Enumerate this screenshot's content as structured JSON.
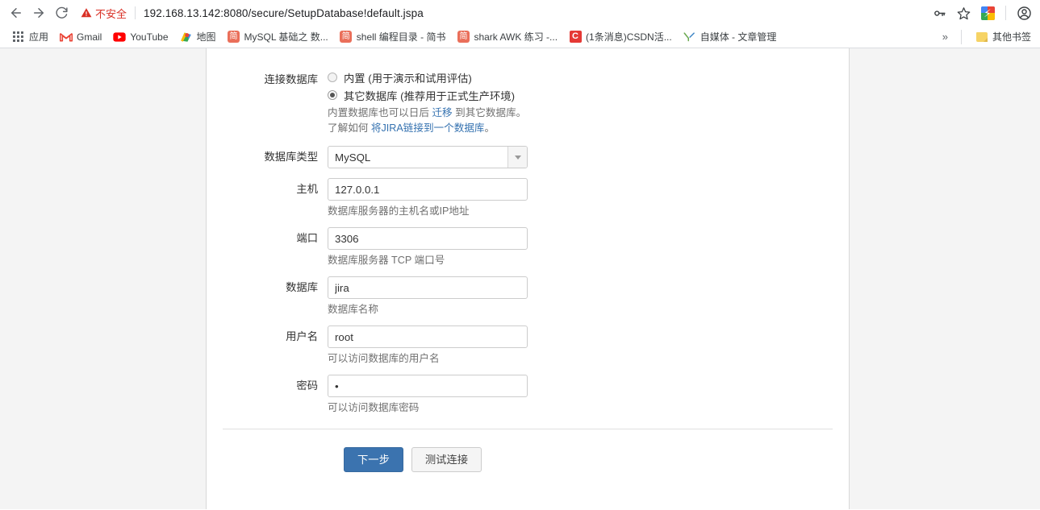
{
  "browser": {
    "nav": {
      "back": "back-arrow",
      "forward": "forward-arrow",
      "reload": "reload"
    },
    "omnibox": {
      "security_label": "不安全",
      "url": "192.168.13.142:8080/secure/SetupDatabase!default.jspa"
    },
    "toolbar_right": {
      "key_icon": "key-icon",
      "star_icon": "star-icon",
      "extension_icon": "extension-icon",
      "profile_icon": "profile-avatar"
    },
    "bookmarks": [
      {
        "label": "应用",
        "icon": "apps-grid"
      },
      {
        "label": "Gmail",
        "icon": "gmail"
      },
      {
        "label": "YouTube",
        "icon": "youtube"
      },
      {
        "label": "地图",
        "icon": "maps"
      },
      {
        "label": "MySQL 基础之 数...",
        "icon": "jianshu"
      },
      {
        "label": "shell 编程目录 - 简书",
        "icon": "jianshu"
      },
      {
        "label": "shark AWK 练习 -...",
        "icon": "jianshu"
      },
      {
        "label": "(1条消息)CSDN活...",
        "icon": "csdn"
      },
      {
        "label": "自媒体 - 文章管理",
        "icon": "weibo-y"
      }
    ],
    "overflow_label": "»",
    "other_bookmarks": "其他书签"
  },
  "form": {
    "connect_db": {
      "label": "连接数据库",
      "option_builtin": "内置 (用于演示和试用评估)",
      "option_external": "其它数据库 (推荐用于正式生产环境)",
      "selected": "external",
      "help_line1_before": "内置数据库也可以日后 ",
      "help_line1_link": "迁移",
      "help_line1_after": " 到其它数据库。",
      "help_line2_before": "了解如何 ",
      "help_line2_link": "将JIRA链接到一个数据库",
      "help_line2_after": "。"
    },
    "db_type": {
      "label": "数据库类型",
      "value": "MySQL"
    },
    "host": {
      "label": "主机",
      "value": "127.0.0.1",
      "hint": "数据库服务器的主机名或IP地址"
    },
    "port": {
      "label": "端口",
      "value": "3306",
      "hint": "数据库服务器 TCP 端口号"
    },
    "database": {
      "label": "数据库",
      "value": "jira",
      "hint": "数据库名称"
    },
    "username": {
      "label": "用户名",
      "value": "root",
      "hint": "可以访问数据库的用户名"
    },
    "password": {
      "label": "密码",
      "value": "•",
      "hint": "可以访问数据库密码"
    },
    "buttons": {
      "next": "下一步",
      "test": "测试连接"
    }
  },
  "colors": {
    "primary_button": "#3b73af",
    "link": "#3572b0",
    "security_warning": "#d93025",
    "page_bg": "#f4f4f4"
  }
}
